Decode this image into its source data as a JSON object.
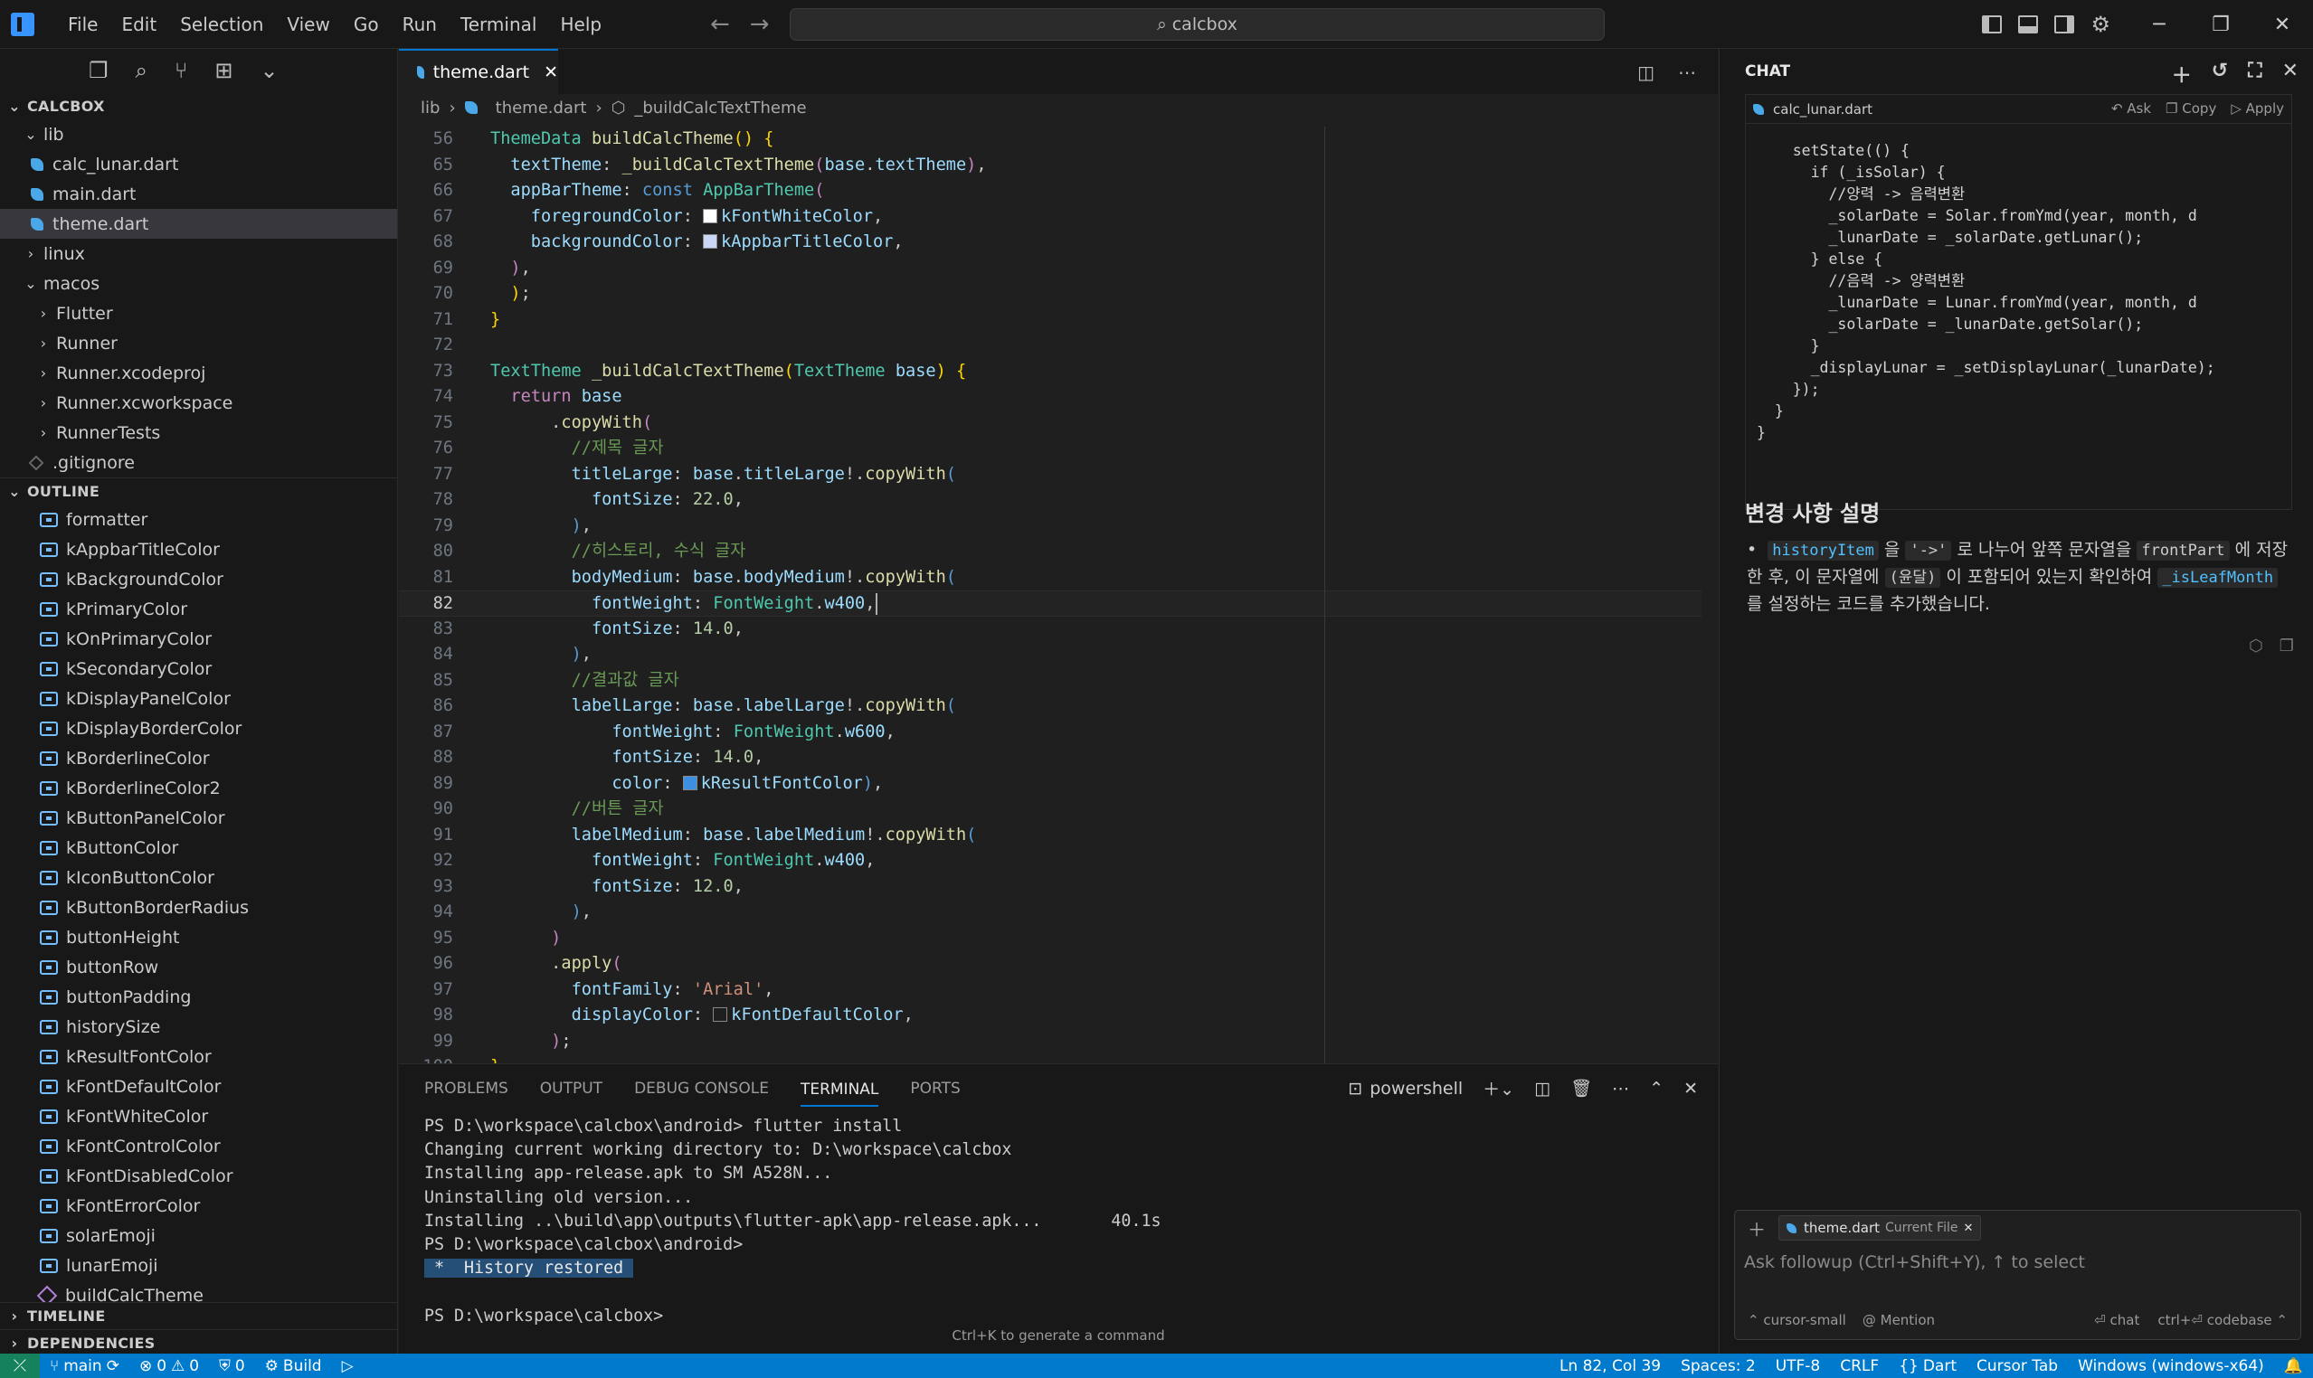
{
  "menu": [
    "File",
    "Edit",
    "Selection",
    "View",
    "Go",
    "Run",
    "Terminal",
    "Help"
  ],
  "search": {
    "text": "calcbox"
  },
  "sidebar": {
    "project": "CALCBOX",
    "tree": [
      {
        "label": "lib",
        "kind": "folder-open",
        "depth": 1
      },
      {
        "label": "calc_lunar.dart",
        "kind": "dart",
        "depth": 2
      },
      {
        "label": "main.dart",
        "kind": "dart",
        "depth": 2
      },
      {
        "label": "theme.dart",
        "kind": "dart",
        "depth": 2,
        "active": true
      },
      {
        "label": "linux",
        "kind": "folder",
        "depth": 1
      },
      {
        "label": "macos",
        "kind": "folder-open",
        "depth": 1
      },
      {
        "label": "Flutter",
        "kind": "folder",
        "depth": 2
      },
      {
        "label": "Runner",
        "kind": "folder",
        "depth": 2
      },
      {
        "label": "Runner.xcodeproj",
        "kind": "folder",
        "depth": 2
      },
      {
        "label": "Runner.xcworkspace",
        "kind": "folder",
        "depth": 2
      },
      {
        "label": "RunnerTests",
        "kind": "folder",
        "depth": 2
      },
      {
        "label": ".gitignore",
        "kind": "git",
        "depth": 2
      }
    ],
    "outline_title": "OUTLINE",
    "outline": [
      "formatter",
      "kAppbarTitleColor",
      "kBackgroundColor",
      "kPrimaryColor",
      "kOnPrimaryColor",
      "kSecondaryColor",
      "kDisplayPanelColor",
      "kDisplayBorderColor",
      "kBorderlineColor",
      "kBorderlineColor2",
      "kButtonPanelColor",
      "kButtonColor",
      "kIconButtonColor",
      "kButtonBorderRadius",
      "buttonHeight",
      "buttonRow",
      "buttonPadding",
      "historySize",
      "kResultFontColor",
      "kFontDefaultColor",
      "kFontWhiteColor",
      "kFontControlColor",
      "kFontDisabledColor",
      "kFontErrorColor",
      "solarEmoji",
      "lunarEmoji",
      "buildCalcTheme"
    ],
    "timeline": "TIMELINE",
    "dependencies": "DEPENDENCIES"
  },
  "editor": {
    "tab": "theme.dart",
    "breadcrumb": [
      "lib",
      "theme.dart",
      "_buildCalcTextTheme"
    ],
    "lines": [
      {
        "n": "56",
        "html": "<span class='t'>ThemeData</span> <span class='f'>buildCalcTheme</span><span class='y'>()</span> <span class='y'>{</span>"
      },
      {
        "n": "65",
        "html": "  <span class='v'>textTheme</span>: <span class='f'>_buildCalcTextTheme</span><span class='c2'>(</span><span class='v'>base</span>.<span class='v'>textTheme</span><span class='c2'>)</span>,"
      },
      {
        "n": "66",
        "html": "  <span class='v'>appBarTheme</span>: <span class='k'>const</span> <span class='t'>AppBarTheme</span><span class='c2'>(</span>"
      },
      {
        "n": "67",
        "html": "    <span class='v'>foregroundColor</span>: <span class='swatch' style='background:#ffffff'></span><span class='v'>kFontWhiteColor</span>,"
      },
      {
        "n": "68",
        "html": "    <span class='v'>backgroundColor</span>: <span class='swatch' style='background:#c9d6f5'></span><span class='v'>kAppbarTitleColor</span>,"
      },
      {
        "n": "69",
        "html": "  <span class='c2'>)</span>,"
      },
      {
        "n": "70",
        "html": "<span class='y'>  )</span>;"
      },
      {
        "n": "71",
        "html": "<span class='y'>}</span>"
      },
      {
        "n": "72",
        "html": ""
      },
      {
        "n": "73",
        "html": "<span class='t'>TextTheme</span> <span class='f'>_buildCalcTextTheme</span><span class='y'>(</span><span class='t'>TextTheme</span> <span class='v'>base</span><span class='y'>)</span> <span class='y'>{</span>"
      },
      {
        "n": "74",
        "html": "  <span class='c2'>return</span> <span class='v'>base</span>"
      },
      {
        "n": "75",
        "html": "      .<span class='f'>copyWith</span><span class='c2'>(</span>"
      },
      {
        "n": "76",
        "html": "        <span class='c'>//제목 글자</span>"
      },
      {
        "n": "77",
        "html": "        <span class='v'>titleLarge</span>: <span class='v'>base</span>.<span class='v'>titleLarge</span>!.<span class='f'>copyWith</span><span class='k'>(</span>"
      },
      {
        "n": "78",
        "html": "          <span class='v'>fontSize</span>: <span class='n'>22.0</span>,"
      },
      {
        "n": "79",
        "html": "        <span class='k'>)</span>,"
      },
      {
        "n": "80",
        "html": "        <span class='c'>//히스토리, 수식 글자</span>"
      },
      {
        "n": "81",
        "html": "        <span class='v'>bodyMedium</span>: <span class='v'>base</span>.<span class='v'>bodyMedium</span>!.<span class='f'>copyWith</span><span class='k'>(</span>"
      },
      {
        "n": "82",
        "html": "          <span class='v'>fontWeight</span>: <span class='t'>FontWeight</span>.<span class='v'>w400</span>,",
        "current": true
      },
      {
        "n": "83",
        "html": "          <span class='v'>fontSize</span>: <span class='n'>14.0</span>,"
      },
      {
        "n": "84",
        "html": "        <span class='k'>)</span>,"
      },
      {
        "n": "85",
        "html": "        <span class='c'>//결과값 글자</span>"
      },
      {
        "n": "86",
        "html": "        <span class='v'>labelLarge</span>: <span class='v'>base</span>.<span class='v'>labelLarge</span>!.<span class='f'>copyWith</span><span class='k'>(</span>"
      },
      {
        "n": "87",
        "html": "            <span class='v'>fontWeight</span>: <span class='t'>FontWeight</span>.<span class='v'>w600</span>,"
      },
      {
        "n": "88",
        "html": "            <span class='v'>fontSize</span>: <span class='n'>14.0</span>,"
      },
      {
        "n": "89",
        "html": "            <span class='v'>color</span>: <span class='swatch' style='background:#3d8fe0'></span><span class='v'>kResultFontColor</span><span class='k'>)</span>,"
      },
      {
        "n": "90",
        "html": "        <span class='c'>//버튼 글자</span>"
      },
      {
        "n": "91",
        "html": "        <span class='v'>labelMedium</span>: <span class='v'>base</span>.<span class='v'>labelMedium</span>!.<span class='f'>copyWith</span><span class='k'>(</span>"
      },
      {
        "n": "92",
        "html": "          <span class='v'>fontWeight</span>: <span class='t'>FontWeight</span>.<span class='v'>w400</span>,"
      },
      {
        "n": "93",
        "html": "          <span class='v'>fontSize</span>: <span class='n'>12.0</span>,"
      },
      {
        "n": "94",
        "html": "        <span class='k'>)</span>,"
      },
      {
        "n": "95",
        "html": "      <span class='c2'>)</span>"
      },
      {
        "n": "96",
        "html": "      .<span class='f'>apply</span><span class='c2'>(</span>"
      },
      {
        "n": "97",
        "html": "        <span class='v'>fontFamily</span>: <span class='s'>'Arial'</span>,"
      },
      {
        "n": "98",
        "html": "        <span class='v'>displayColor</span>: <span class='swatch' style='background:#1f1f1f'></span><span class='v'>kFontDefaultColor</span>,"
      },
      {
        "n": "99",
        "html": "      <span class='c2'>)</span>;"
      },
      {
        "n": "100",
        "html": "<span class='y'>}</span>"
      }
    ]
  },
  "panel": {
    "tabs": [
      "PROBLEMS",
      "OUTPUT",
      "DEBUG CONSOLE",
      "TERMINAL",
      "PORTS"
    ],
    "active_tab": "TERMINAL",
    "shell": "powershell",
    "terminal": [
      "PS D:\\workspace\\calcbox\\android> flutter install",
      "Changing current working directory to: D:\\workspace\\calcbox",
      "Installing app-release.apk to SM A528N...",
      "Uninstalling old version...",
      "Installing ..\\build\\app\\outputs\\flutter-apk\\app-release.apk...       40.1s",
      "PS D:\\workspace\\calcbox\\android>"
    ],
    "history_restored": " *  History restored ",
    "prompt": "PS D:\\workspace\\calcbox>",
    "hint": "Ctrl+K to generate a command"
  },
  "chat": {
    "title": "CHAT",
    "code_file": "calc_lunar.dart",
    "code_actions": [
      "Ask",
      "Copy",
      "Apply"
    ],
    "code_lines": [
      "    setState(() {",
      "      if (_isSolar) {",
      "        //양력 -> 음력변환",
      "        _solarDate = Solar.fromYmd(year, month, d",
      "        _lunarDate = _solarDate.getLunar();",
      "      } else {",
      "        //음력 -> 양력변환",
      "        _lunarDate = Lunar.fromYmd(year, month, d",
      "        _solarDate = _lunarDate.getSolar();",
      "      }",
      "      _displayLunar = _setDisplayLunar(_lunarDate);",
      "    });",
      "  }",
      "}"
    ],
    "heading": "변경 사항 설명",
    "para": {
      "w1": "historyItem",
      "t1": " 을 ",
      "w2": "'->'",
      "t2": " 로 나누어 앞쪽 문자열을 ",
      "w3": "frontPart",
      "t3": " 에 저장한 후, 이 문자열에 ",
      "w4": "(윤달)",
      "t4": " 이 포함되어 있는지 확인하여 ",
      "w5": "_isLeafMonth",
      "t5": " 를 설정하는 코드를 추가했습니다."
    },
    "input": {
      "chip_file": "theme.dart",
      "chip_sub": "Current File",
      "placeholder": "Ask followup (Ctrl+Shift+Y), ↑ to select",
      "model": "cursor-small",
      "mention": "Mention",
      "chat": "chat",
      "codebase": "ctrl+⏎ codebase"
    }
  },
  "status": {
    "branch": "main",
    "errors": "0",
    "warnings": "0",
    "ports": "0",
    "build": "Build",
    "position": "Ln 82, Col 39",
    "spaces": "Spaces: 2",
    "encoding": "UTF-8",
    "eol": "CRLF",
    "language": "Dart",
    "cursor_tab": "Cursor Tab",
    "platform": "Windows (windows-x64)"
  }
}
